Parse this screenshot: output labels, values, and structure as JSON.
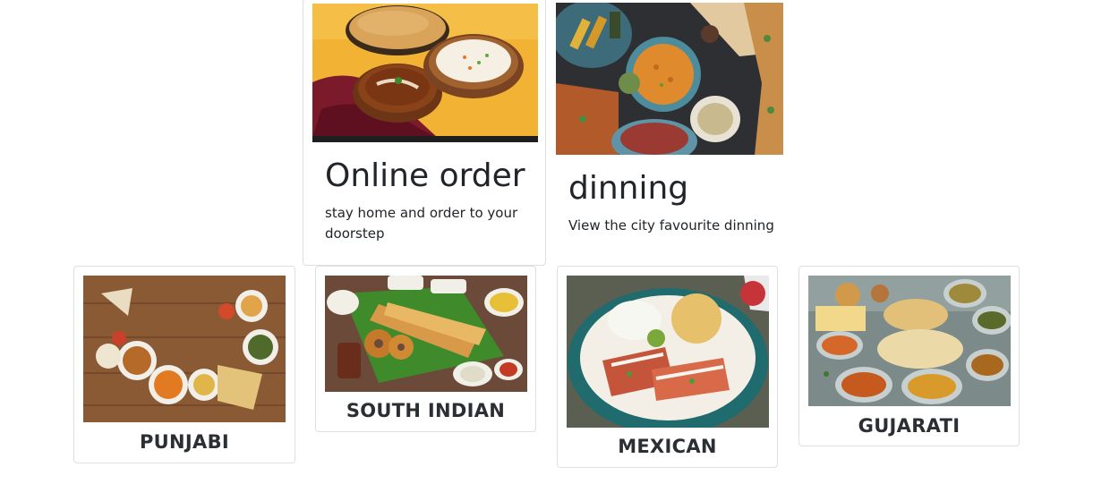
{
  "features": [
    {
      "title": "Online order",
      "text": "stay home and order to your doorstep",
      "image_icon": "indian-meal-photo"
    },
    {
      "title": "dinning",
      "text": "View the city favourite dinning",
      "image_icon": "food-spread-photo"
    }
  ],
  "cuisines": [
    {
      "name": "PUNJABI",
      "image_icon": "punjabi-dishes-photo"
    },
    {
      "name": "SOUTH INDIAN",
      "image_icon": "dosa-plate-photo"
    },
    {
      "name": "MEXICAN",
      "image_icon": "mexican-platter-photo"
    },
    {
      "name": "GUJARATI",
      "image_icon": "gujarati-thali-photo"
    }
  ],
  "colors": {
    "text": "#212529",
    "card_border": "#dcdfe3",
    "background": "#ffffff"
  }
}
